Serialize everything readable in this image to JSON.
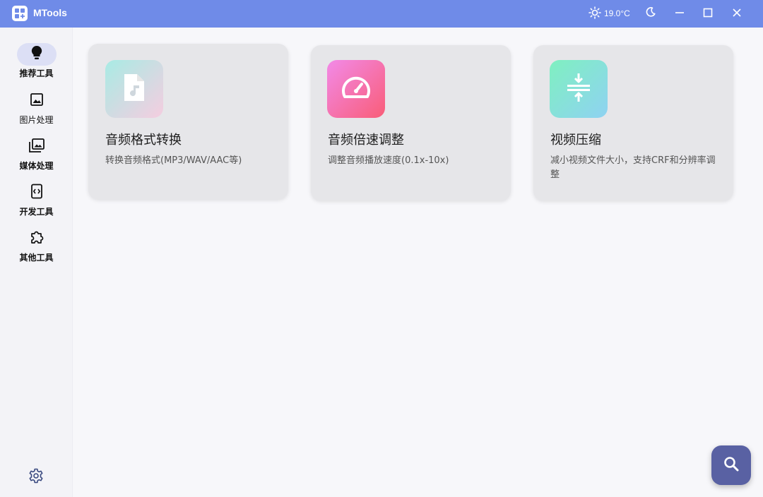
{
  "app": {
    "title": "MTools",
    "weather": "19.0°C"
  },
  "colors": {
    "titlebar": "#6f8be8",
    "sidebar_active": "#dcdff5",
    "fab": "#5961a3"
  },
  "sidebar": {
    "items": [
      {
        "label": "推荐工具",
        "icon": "lightbulb-icon",
        "active": true
      },
      {
        "label": "图片处理",
        "icon": "image-icon",
        "active": false
      },
      {
        "label": "媒体处理",
        "icon": "photo-library-icon",
        "active": false
      },
      {
        "label": "开发工具",
        "icon": "code-icon",
        "active": false
      },
      {
        "label": "其他工具",
        "icon": "puzzle-icon",
        "active": false
      }
    ],
    "settings_icon": "gear-icon"
  },
  "cards": [
    {
      "title": "音频格式转换",
      "desc": "转换音频格式(MP3/WAV/AAC等)",
      "icon": "audio-file-icon"
    },
    {
      "title": "音频倍速调整",
      "desc": "调整音频播放速度(0.1x-10x)",
      "icon": "speedometer-icon"
    },
    {
      "title": "视频压缩",
      "desc": "减小视频文件大小，支持CRF和分辨率调整",
      "icon": "compress-icon"
    }
  ],
  "fab": {
    "icon": "search-icon"
  }
}
